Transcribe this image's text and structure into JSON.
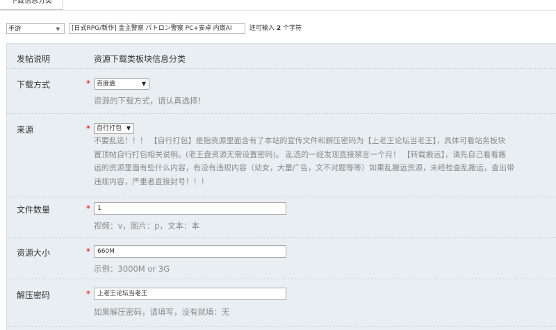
{
  "tab": {
    "label": "下载信息分类"
  },
  "title_row": {
    "type_select": "手游",
    "title_value": "[日式RPG/新作] 金主警察 パトロン警察 PC+安卓 内嵌AI",
    "counter_prefix": "还可输入",
    "counter_count": "2",
    "counter_suffix": "个字符"
  },
  "form": {
    "post_desc": {
      "label": "发帖说明",
      "text": "资源下载类板块信息分类"
    },
    "download_method": {
      "label": "下载方式",
      "selected": "百度盘",
      "hint": "资源的下载方式，请认真选择！"
    },
    "source": {
      "label": "来源",
      "selected": "自行打包",
      "lines": [
        "不要乱选！！！ 【自行打包】是指资源里面含有了本站的宣传文件和解压密码为【上老王论坛当老王】，具体可看站务板块",
        "置顶帖自行打包相关说明。(老王盘资源无需设置密码)。 乱选的一经发现直接禁言一个月！ 【转载搬运】，请先自己看看搬",
        "运的资源里面有些什么内容，有没有违规内容（幼女，大量广告，文不对题等等）如果乱搬运资源，未经检查乱搬运，查出带",
        "违规内容，严重者直接封号！！！"
      ]
    },
    "file_count": {
      "label": "文件数量",
      "value": "1",
      "hint": "视频：v，图片：p，文本：本"
    },
    "size": {
      "label": "资源大小",
      "value": "660M",
      "hint": "示例：3000M or 3G"
    },
    "password": {
      "label": "解压密码",
      "value": "上老王论坛当老王",
      "hint": "如果解压密码，请填写，没有就填：无"
    }
  },
  "colors": {
    "required": "#e00000",
    "panel_bg": "#e8eef2"
  }
}
